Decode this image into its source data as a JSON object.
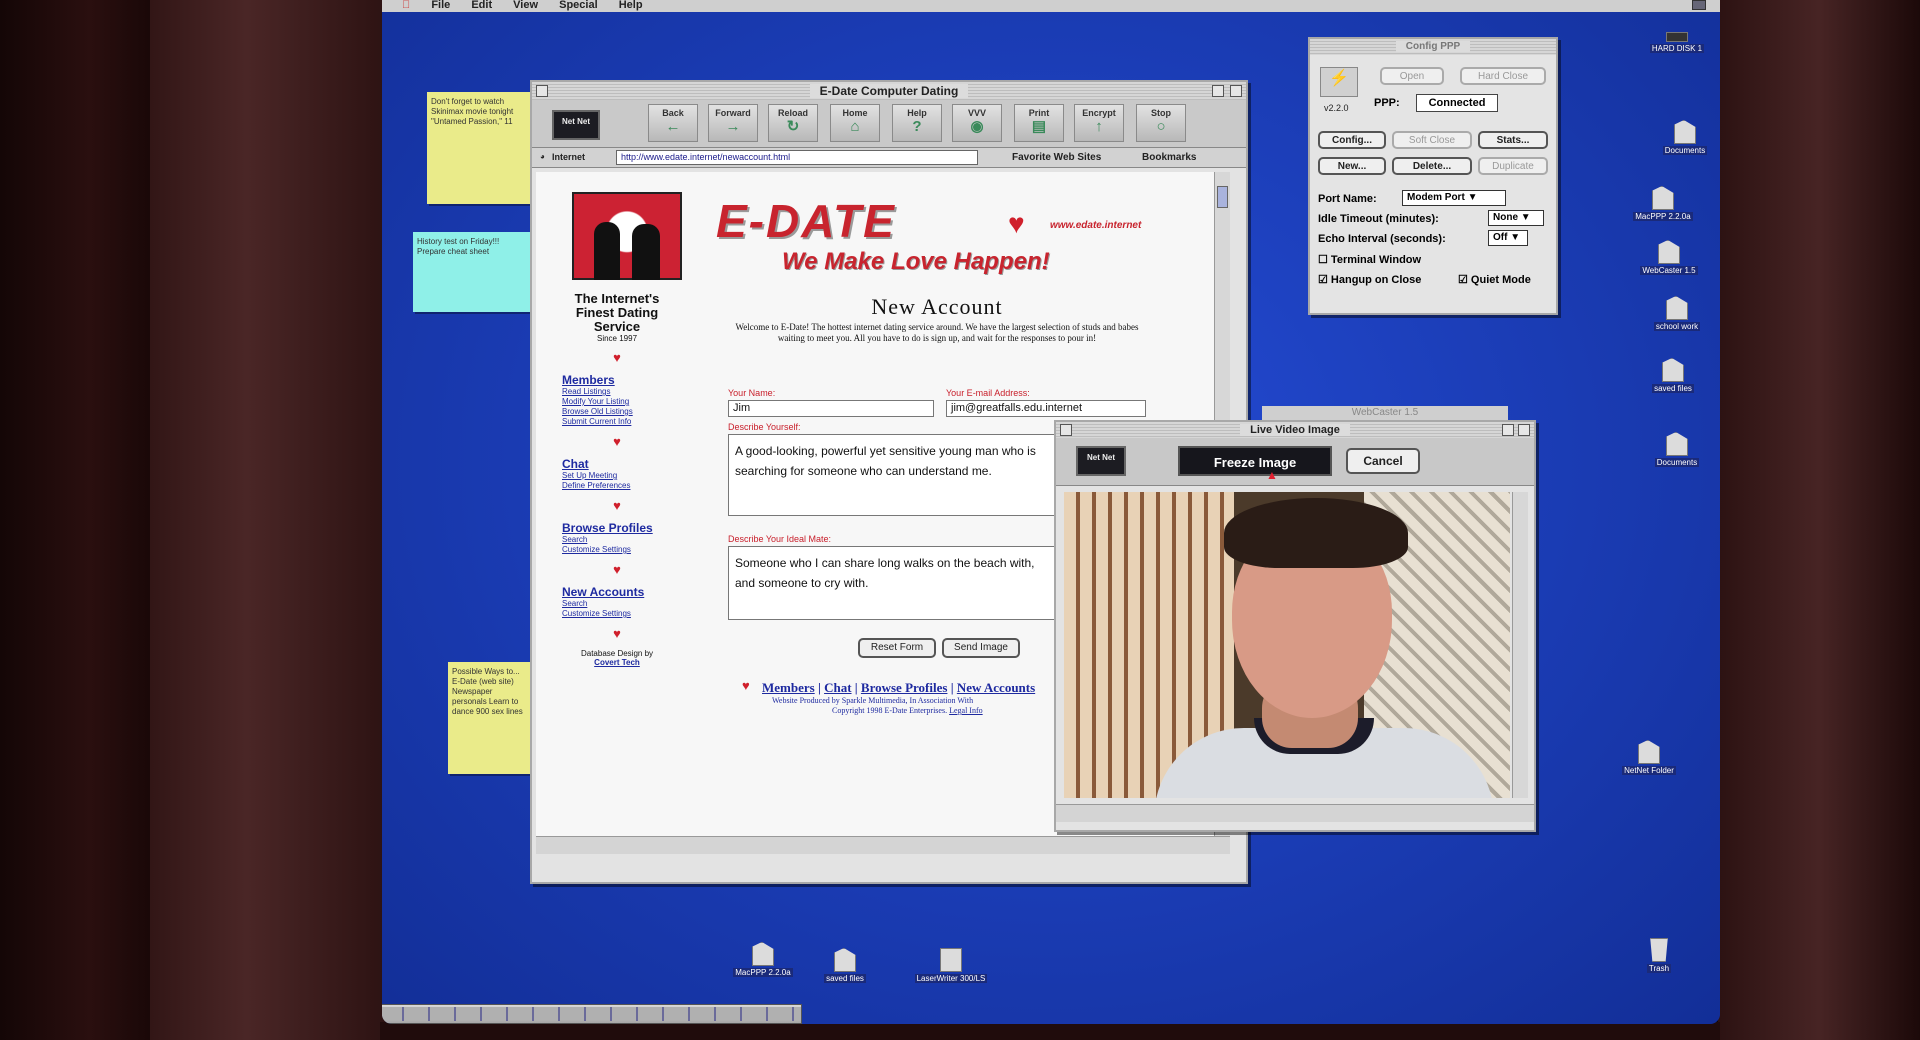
{
  "menubar": {
    "items": [
      "File",
      "Edit",
      "View",
      "Special",
      "Help"
    ]
  },
  "sticky_notes": [
    {
      "text": "Don't forget to watch Skinimax movie tonight \"Untamed Passion,\" 11"
    },
    {
      "text": "History test on Friday!!! Prepare cheat sheet"
    },
    {
      "text": "Possible Ways to... E-Date (web site) Newspaper personals Learn to dance 900 sex lines"
    }
  ],
  "browser": {
    "title": "E-Date Computer Dating",
    "logo": "Net Net",
    "toolbar": [
      "Back",
      "Forward",
      "Reload",
      "Home",
      "Help",
      "VVV",
      "Print",
      "Encrypt",
      "Stop"
    ],
    "address_label": "Internet",
    "url": "http://www.edate.internet/newaccount.html",
    "links": [
      "Favorite Web Sites",
      "Bookmarks"
    ]
  },
  "page": {
    "tagline": "The Internet's Finest Dating Service",
    "since": "Since 1997",
    "banner_title": "E-DATE",
    "banner_url": "www.edate.internet",
    "banner_slogan": "We Make Love Happen!",
    "heading": "New Account",
    "welcome": "Welcome to E-Date! The hottest internet dating service around. We have the largest selection of studs and babes waiting to meet you. All you have to do is sign up, and wait for the responses to pour in!",
    "nav": [
      {
        "head": "Members",
        "links": [
          "Read Listings",
          "Modify Your Listing",
          "Browse Old Listings",
          "Submit Current Info"
        ]
      },
      {
        "head": "Chat",
        "links": [
          "Set Up Meeting",
          "Define Preferences"
        ]
      },
      {
        "head": "Browse Profiles",
        "links": [
          "Search",
          "Customize Settings"
        ]
      },
      {
        "head": "New Accounts",
        "links": [
          "Search",
          "Customize Settings"
        ]
      }
    ],
    "credit_line": "Database Design by",
    "credit_name": "Covert Tech",
    "form": {
      "name_label": "Your Name:",
      "name_value": "Jim",
      "email_label": "Your E-mail Address:",
      "email_value": "jim@greatfalls.edu.internet",
      "describe_label": "Describe Yourself:",
      "describe_value": "A good-looking, powerful yet sensitive young man who is searching for someone who can understand me.",
      "ideal_label": "Describe Your Ideal Mate:",
      "ideal_value": "Someone who I can share long walks on the beach with, and someone to cry with.",
      "reset": "Reset Form",
      "send": "Send Image"
    },
    "footer_links": [
      "Members",
      "Chat",
      "Browse Profiles",
      "New Accounts"
    ],
    "footer_credit": "Website Produced by Sparkle Multimedia, In Association With",
    "copyright": "Copyright 1998 E-Date Enterprises.",
    "legal": "Legal Info"
  },
  "ppp": {
    "title": "Config PPP",
    "version": "v2.2.0",
    "buttons_top": [
      "Open",
      "Hard Close"
    ],
    "status_label": "PPP:",
    "status": "Connected",
    "buttons": [
      "Config...",
      "Soft Close",
      "Stats...",
      "New...",
      "Delete...",
      "Duplicate"
    ],
    "port_label": "Port Name:",
    "port_value": "Modem Port",
    "idle_label": "Idle Timeout (minutes):",
    "idle_value": "None",
    "echo_label": "Echo Interval (seconds):",
    "echo_value": "Off",
    "terminal": "Terminal Window",
    "hangup": "Hangup on Close",
    "quiet": "Quiet Mode"
  },
  "video": {
    "back_title": "WebCaster 1.5",
    "title": "Live Video Image",
    "logo": "Net Net",
    "freeze": "Freeze Image",
    "cancel": "Cancel"
  },
  "desktop_icons": [
    "HARD DISK 1",
    "Documents",
    "MacPPP 2.2.0a",
    "WebCaster 1.5",
    "school work",
    "saved files",
    "Documents",
    "NetNet Folder",
    "MacPPP 2.2.0a",
    "saved files",
    "LaserWriter 300/LS",
    "Trash"
  ]
}
